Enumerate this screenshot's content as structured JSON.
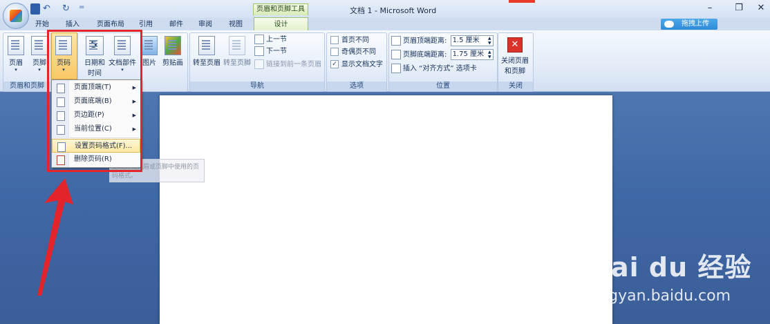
{
  "window": {
    "doc_title": "文档 1 - Microsoft Word",
    "tool_context": "页眉和页脚工具",
    "controls": {
      "minimize": "–",
      "restore": "❐",
      "close": "✕"
    }
  },
  "qat": {
    "undo_icon": "↶",
    "redo_icon": "↻",
    "more": "="
  },
  "tabs": [
    "开始",
    "插入",
    "页面布局",
    "引用",
    "邮件",
    "审阅",
    "视图"
  ],
  "active_tab": "设计",
  "upload_button": "拖拽上传",
  "ribbon": {
    "group_header_footer": {
      "label": "页眉和页脚",
      "header": "页眉",
      "footer": "页脚",
      "page_number": "页码"
    },
    "group_insert": {
      "date_time_line1": "日期和",
      "date_time_line2": "时间",
      "quick_parts": "文档部件",
      "picture": "图片",
      "clipart": "剪贴画",
      "date_icon_text": "5"
    },
    "group_navigation": {
      "label": "导航",
      "goto_header": "转至页眉",
      "goto_footer": "转至页脚",
      "prev": "上一节",
      "next": "下一节",
      "link_prev": "链接到前一条页眉"
    },
    "group_options": {
      "label": "选项",
      "first_page": "首页不同",
      "odd_even": "奇偶页不同",
      "show_text": "显示文档文字",
      "check_mark": "✓"
    },
    "group_position": {
      "label": "位置",
      "header_dist_label": "页眉顶端距离:",
      "header_dist_value": "1.5 厘米",
      "footer_dist_label": "页脚底端距离:",
      "footer_dist_value": "1.75 厘米",
      "insert_tab": "插入 “对齐方式” 选项卡"
    },
    "group_close": {
      "label": "关闭",
      "close_line1": "关闭页眉",
      "close_line2": "和页脚"
    }
  },
  "dropdown": {
    "items": [
      {
        "label": "页面顶端(T)",
        "submenu": "▶"
      },
      {
        "label": "页面底端(B)",
        "submenu": "▶"
      },
      {
        "label": "页边距(P)",
        "submenu": "▶"
      },
      {
        "label": "当前位置(C)",
        "submenu": "▶"
      },
      {
        "label": "设置页码格式(F)...",
        "submenu": ""
      },
      {
        "label": "删除页码(R)",
        "submenu": ""
      }
    ],
    "tooltip": "更改文档页眉或页脚中使用的页码格式。"
  },
  "watermark": {
    "brand": "Bai du 经验",
    "url": "jingyan.baidu.com"
  },
  "colors": {
    "highlight_frame": "#e3242b",
    "arrow": "#e3242b"
  }
}
